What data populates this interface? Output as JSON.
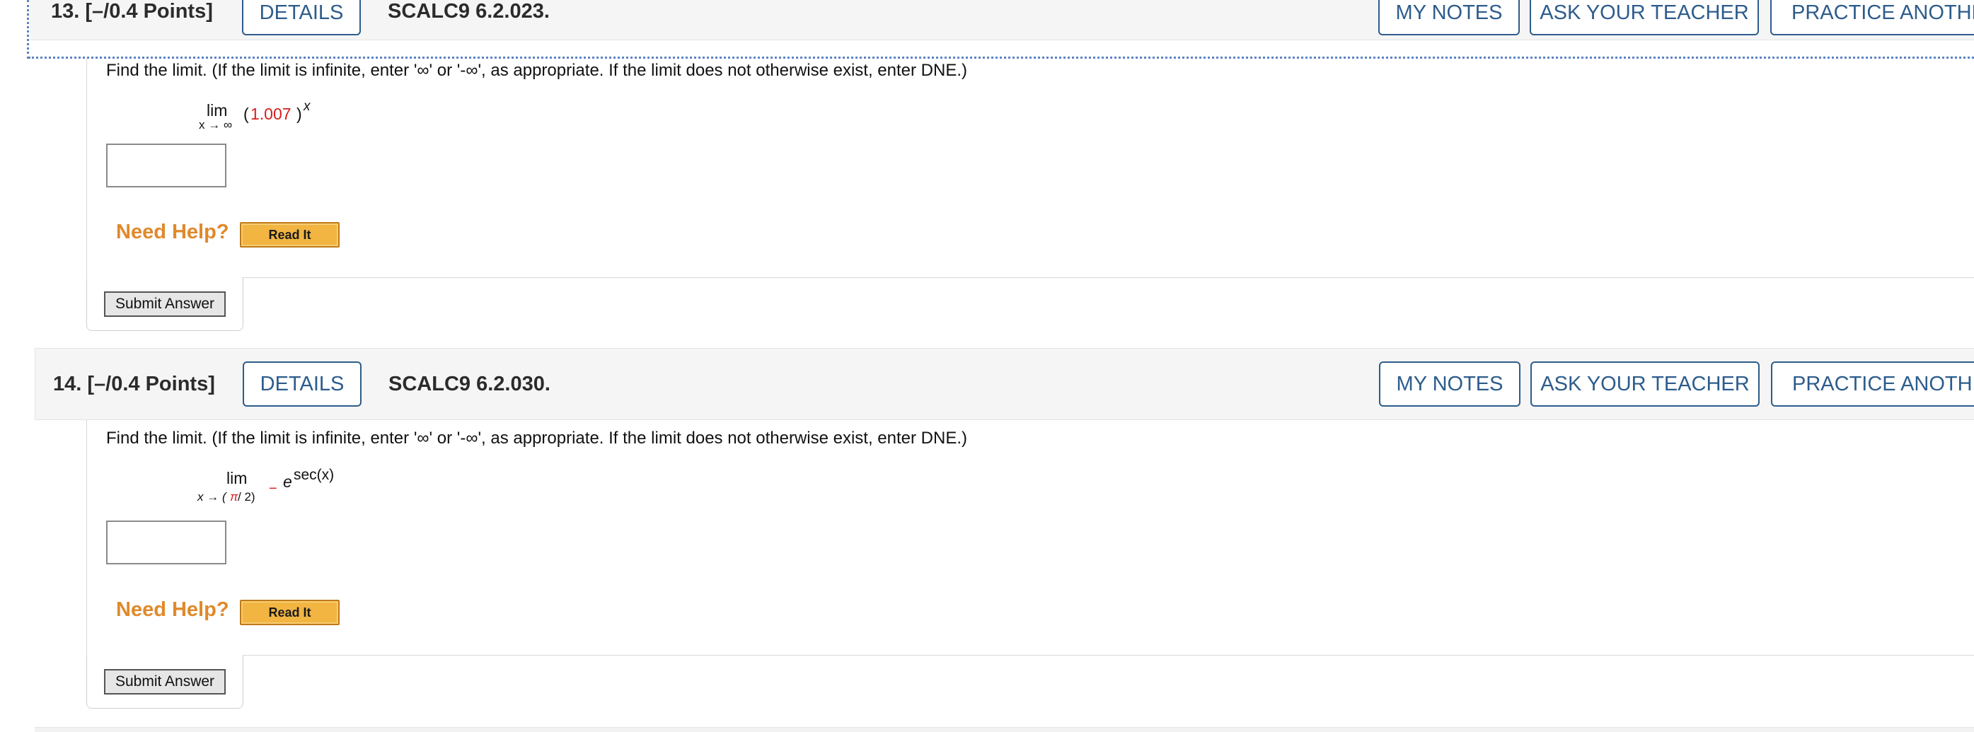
{
  "questions": [
    {
      "number_label": "13.  [–/0.4 Points]",
      "details_label": "DETAILS",
      "code": "SCALC9 6.2.023.",
      "my_notes_label": "MY NOTES",
      "ask_teacher_label": "ASK YOUR TEACHER",
      "practice_label": "PRACTICE ANOTHER",
      "prompt": "Find the limit. (If the limit is infinite, enter '∞' or '-∞', as appropriate. If the limit does not otherwise exist, enter DNE.)",
      "limit_word": "lim",
      "limit_sub": "x → ∞",
      "base_open": "(",
      "base_value": "1.007",
      "base_close": ")",
      "exponent": "x",
      "answer_value": "",
      "need_help_label": "Need Help?",
      "read_it_label": "Read It",
      "submit_label": "Submit Answer"
    },
    {
      "number_label": "14.  [–/0.4 Points]",
      "details_label": "DETAILS",
      "code": "SCALC9 6.2.030.",
      "my_notes_label": "MY NOTES",
      "ask_teacher_label": "ASK YOUR TEACHER",
      "practice_label": "PRACTICE ANOTHER",
      "prompt": "Find the limit. (If the limit is infinite, enter '∞' or '-∞', as appropriate. If the limit does not otherwise exist, enter DNE.)",
      "limit_word": "lim",
      "limit_sub_prefix": "x → (",
      "limit_sub_pi": "π",
      "limit_sub_suffix": " / 2)",
      "limit_sub_minus": "−",
      "base": "e",
      "exponent": "sec(x)",
      "answer_value": "",
      "need_help_label": "Need Help?",
      "read_it_label": "Read It",
      "submit_label": "Submit Answer"
    }
  ],
  "colors": {
    "accent": "#2d5c8c",
    "need_help": "#e0892b",
    "highlight_red": "#d81e1e",
    "read_it_bg": "#f2b542"
  }
}
